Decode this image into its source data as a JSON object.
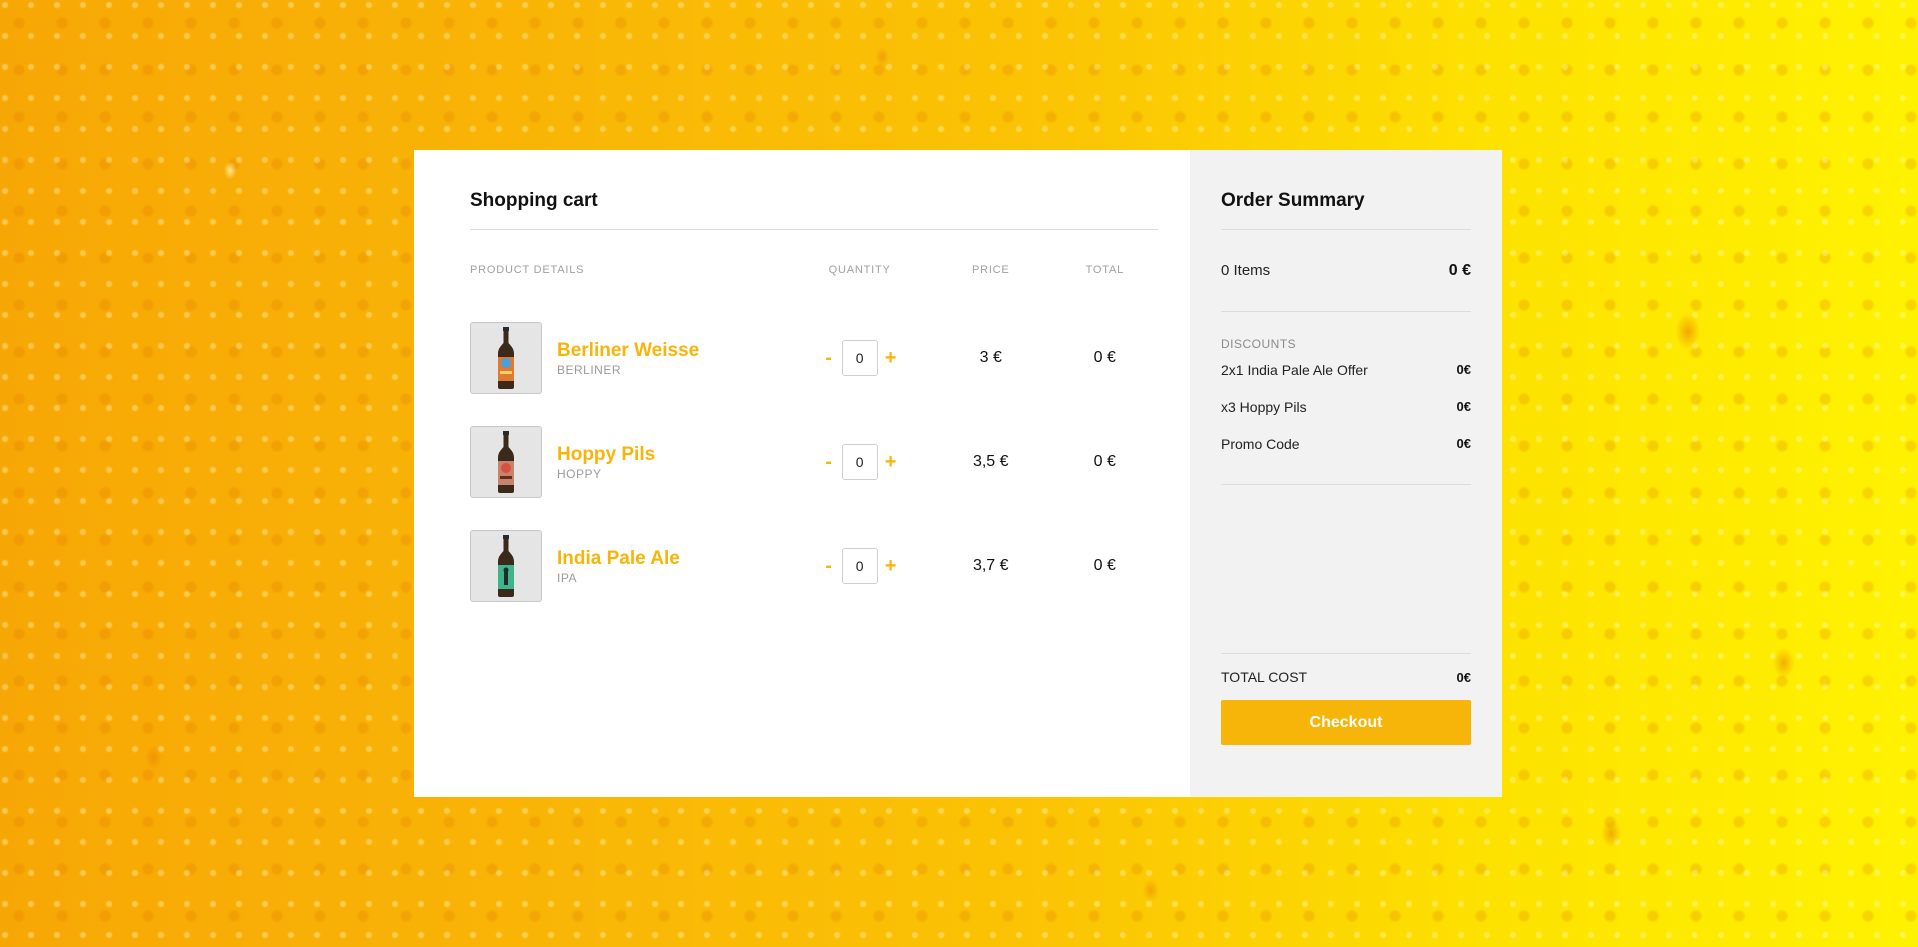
{
  "cart": {
    "title": "Shopping cart",
    "columns": {
      "product": "PRODUCT DETAILS",
      "quantity": "QUANTITY",
      "price": "PRICE",
      "total": "TOTAL"
    },
    "minus_label": "-",
    "plus_label": "+",
    "items": [
      {
        "name": "Berliner Weisse",
        "code": "BERLINER",
        "quantity": "0",
        "price": "3 €",
        "total": "0 €",
        "label_color": "#4aa0d8",
        "icon": "beer-bottle-icon"
      },
      {
        "name": "Hoppy Pils",
        "code": "HOPPY",
        "quantity": "0",
        "price": "3,5 €",
        "total": "0 €",
        "label_color": "#d9503f",
        "icon": "beer-bottle-icon"
      },
      {
        "name": "India Pale Ale",
        "code": "IPA",
        "quantity": "0",
        "price": "3,7 €",
        "total": "0 €",
        "label_color": "#3fb38a",
        "icon": "beer-bottle-icon"
      }
    ]
  },
  "summary": {
    "title": "Order Summary",
    "items_label": "0 Items",
    "items_value": "0 €",
    "discounts_heading": "DISCOUNTS",
    "discounts": [
      {
        "label": "2x1 India Pale Ale Offer",
        "value": "0€"
      },
      {
        "label": "x3 Hoppy Pils",
        "value": "0€"
      },
      {
        "label": "Promo Code",
        "value": "0€"
      }
    ],
    "total_label": "TOTAL COST",
    "total_value": "0€",
    "checkout_label": "Checkout"
  },
  "colors": {
    "accent": "#f7b50a",
    "summary_bg": "#f2f2f2"
  }
}
